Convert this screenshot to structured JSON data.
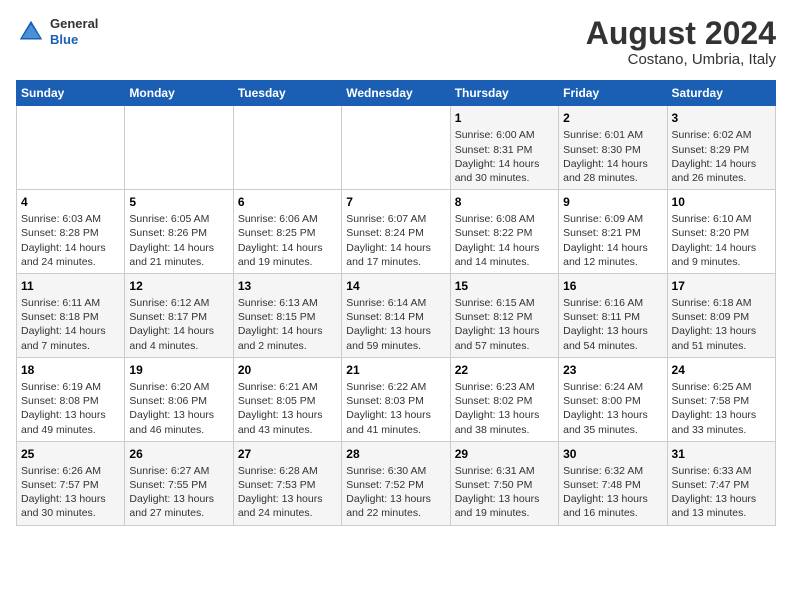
{
  "header": {
    "logo_general": "General",
    "logo_blue": "Blue",
    "title": "August 2024",
    "subtitle": "Costano, Umbria, Italy"
  },
  "days_of_week": [
    "Sunday",
    "Monday",
    "Tuesday",
    "Wednesday",
    "Thursday",
    "Friday",
    "Saturday"
  ],
  "weeks": [
    [
      {
        "day": "",
        "info": ""
      },
      {
        "day": "",
        "info": ""
      },
      {
        "day": "",
        "info": ""
      },
      {
        "day": "",
        "info": ""
      },
      {
        "day": "1",
        "info": "Sunrise: 6:00 AM\nSunset: 8:31 PM\nDaylight: 14 hours\nand 30 minutes."
      },
      {
        "day": "2",
        "info": "Sunrise: 6:01 AM\nSunset: 8:30 PM\nDaylight: 14 hours\nand 28 minutes."
      },
      {
        "day": "3",
        "info": "Sunrise: 6:02 AM\nSunset: 8:29 PM\nDaylight: 14 hours\nand 26 minutes."
      }
    ],
    [
      {
        "day": "4",
        "info": "Sunrise: 6:03 AM\nSunset: 8:28 PM\nDaylight: 14 hours\nand 24 minutes."
      },
      {
        "day": "5",
        "info": "Sunrise: 6:05 AM\nSunset: 8:26 PM\nDaylight: 14 hours\nand 21 minutes."
      },
      {
        "day": "6",
        "info": "Sunrise: 6:06 AM\nSunset: 8:25 PM\nDaylight: 14 hours\nand 19 minutes."
      },
      {
        "day": "7",
        "info": "Sunrise: 6:07 AM\nSunset: 8:24 PM\nDaylight: 14 hours\nand 17 minutes."
      },
      {
        "day": "8",
        "info": "Sunrise: 6:08 AM\nSunset: 8:22 PM\nDaylight: 14 hours\nand 14 minutes."
      },
      {
        "day": "9",
        "info": "Sunrise: 6:09 AM\nSunset: 8:21 PM\nDaylight: 14 hours\nand 12 minutes."
      },
      {
        "day": "10",
        "info": "Sunrise: 6:10 AM\nSunset: 8:20 PM\nDaylight: 14 hours\nand 9 minutes."
      }
    ],
    [
      {
        "day": "11",
        "info": "Sunrise: 6:11 AM\nSunset: 8:18 PM\nDaylight: 14 hours\nand 7 minutes."
      },
      {
        "day": "12",
        "info": "Sunrise: 6:12 AM\nSunset: 8:17 PM\nDaylight: 14 hours\nand 4 minutes."
      },
      {
        "day": "13",
        "info": "Sunrise: 6:13 AM\nSunset: 8:15 PM\nDaylight: 14 hours\nand 2 minutes."
      },
      {
        "day": "14",
        "info": "Sunrise: 6:14 AM\nSunset: 8:14 PM\nDaylight: 13 hours\nand 59 minutes."
      },
      {
        "day": "15",
        "info": "Sunrise: 6:15 AM\nSunset: 8:12 PM\nDaylight: 13 hours\nand 57 minutes."
      },
      {
        "day": "16",
        "info": "Sunrise: 6:16 AM\nSunset: 8:11 PM\nDaylight: 13 hours\nand 54 minutes."
      },
      {
        "day": "17",
        "info": "Sunrise: 6:18 AM\nSunset: 8:09 PM\nDaylight: 13 hours\nand 51 minutes."
      }
    ],
    [
      {
        "day": "18",
        "info": "Sunrise: 6:19 AM\nSunset: 8:08 PM\nDaylight: 13 hours\nand 49 minutes."
      },
      {
        "day": "19",
        "info": "Sunrise: 6:20 AM\nSunset: 8:06 PM\nDaylight: 13 hours\nand 46 minutes."
      },
      {
        "day": "20",
        "info": "Sunrise: 6:21 AM\nSunset: 8:05 PM\nDaylight: 13 hours\nand 43 minutes."
      },
      {
        "day": "21",
        "info": "Sunrise: 6:22 AM\nSunset: 8:03 PM\nDaylight: 13 hours\nand 41 minutes."
      },
      {
        "day": "22",
        "info": "Sunrise: 6:23 AM\nSunset: 8:02 PM\nDaylight: 13 hours\nand 38 minutes."
      },
      {
        "day": "23",
        "info": "Sunrise: 6:24 AM\nSunset: 8:00 PM\nDaylight: 13 hours\nand 35 minutes."
      },
      {
        "day": "24",
        "info": "Sunrise: 6:25 AM\nSunset: 7:58 PM\nDaylight: 13 hours\nand 33 minutes."
      }
    ],
    [
      {
        "day": "25",
        "info": "Sunrise: 6:26 AM\nSunset: 7:57 PM\nDaylight: 13 hours\nand 30 minutes."
      },
      {
        "day": "26",
        "info": "Sunrise: 6:27 AM\nSunset: 7:55 PM\nDaylight: 13 hours\nand 27 minutes."
      },
      {
        "day": "27",
        "info": "Sunrise: 6:28 AM\nSunset: 7:53 PM\nDaylight: 13 hours\nand 24 minutes."
      },
      {
        "day": "28",
        "info": "Sunrise: 6:30 AM\nSunset: 7:52 PM\nDaylight: 13 hours\nand 22 minutes."
      },
      {
        "day": "29",
        "info": "Sunrise: 6:31 AM\nSunset: 7:50 PM\nDaylight: 13 hours\nand 19 minutes."
      },
      {
        "day": "30",
        "info": "Sunrise: 6:32 AM\nSunset: 7:48 PM\nDaylight: 13 hours\nand 16 minutes."
      },
      {
        "day": "31",
        "info": "Sunrise: 6:33 AM\nSunset: 7:47 PM\nDaylight: 13 hours\nand 13 minutes."
      }
    ]
  ]
}
